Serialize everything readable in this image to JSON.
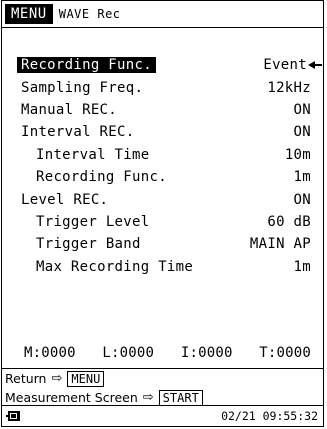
{
  "header": {
    "menu_label": "MENU",
    "title": "WAVE Rec"
  },
  "rows": [
    {
      "label": "Recording Func.",
      "value": "Event"
    },
    {
      "label": "Sampling Freq.",
      "value": "12kHz"
    },
    {
      "label": "Manual REC.",
      "value": "ON"
    },
    {
      "label": "Interval REC.",
      "value": "ON"
    },
    {
      "label": "Interval Time",
      "value": "10m"
    },
    {
      "label": "Recording Func.",
      "value": "1m"
    },
    {
      "label": "Level REC.",
      "value": "ON"
    },
    {
      "label": "Trigger Level",
      "value": "60 dB"
    },
    {
      "label": "Trigger Band",
      "value": "MAIN AP"
    },
    {
      "label": "Max Recording Time",
      "value": "1m"
    }
  ],
  "counters": {
    "m": "M:0000",
    "l": "L:0000",
    "i": "I:0000",
    "t": "T:0000"
  },
  "footer": {
    "return_label": "Return",
    "return_key": "MENU",
    "measure_label": "Measurement Screen",
    "measure_key": "START",
    "arrow_glyph": "⇨",
    "datetime": "02/21 09:55:32"
  },
  "icons": {
    "selection_arrow": "arrow-left-icon",
    "battery": "battery-icon"
  }
}
